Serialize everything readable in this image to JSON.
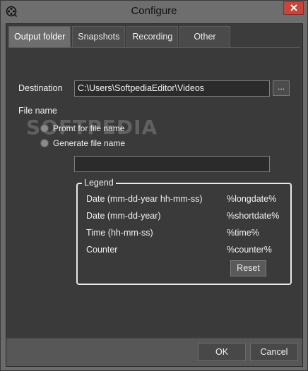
{
  "window": {
    "title": "Configure"
  },
  "tabs": [
    {
      "label": "Output folder",
      "active": true
    },
    {
      "label": "Snapshots",
      "active": false
    },
    {
      "label": "Recording",
      "active": false
    },
    {
      "label": "Other",
      "active": false
    }
  ],
  "output": {
    "destination_label": "Destination",
    "destination_value": "C:\\Users\\SoftpediaEditor\\Videos",
    "browse_label": "...",
    "file_name_label": "File name",
    "radio_prompt": "Promt for file name",
    "radio_generate": "Generate file name",
    "pattern_value": ""
  },
  "watermark": "SOFTPEDIA",
  "legend": {
    "title": "Legend",
    "rows": [
      {
        "key": "Date (mm-dd-year hh-mm-ss)",
        "value": "%longdate%"
      },
      {
        "key": "Date (mm-dd-year)",
        "value": "%shortdate%"
      },
      {
        "key": "Time (hh-mm-ss)",
        "value": "%time%"
      },
      {
        "key": "Counter",
        "value": "%counter%"
      }
    ],
    "reset_label": "Reset"
  },
  "footer": {
    "ok_label": "OK",
    "cancel_label": "Cancel"
  },
  "colors": {
    "close_button": "#c7453a",
    "panel": "#3a3a3a"
  }
}
